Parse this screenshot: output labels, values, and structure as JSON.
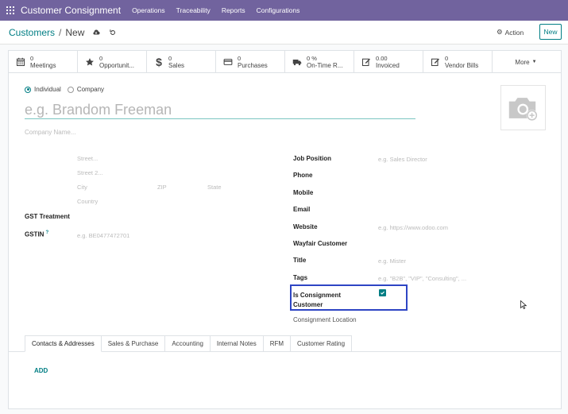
{
  "app": {
    "title": "Customer Consignment"
  },
  "menu": [
    "Operations",
    "Traceability",
    "Reports",
    "Configurations"
  ],
  "breadcrumb": {
    "parent": "Customers",
    "sep": "/",
    "current": "New"
  },
  "toolbar": {
    "action_label": "Action",
    "new_label": "New"
  },
  "smart_buttons": [
    {
      "value": "0",
      "label": "Meetings",
      "icon": "calendar-icon"
    },
    {
      "value": "0",
      "label": "Opportunit...",
      "icon": "star-icon"
    },
    {
      "value": "0",
      "label": "Sales",
      "icon": "dollar-icon"
    },
    {
      "value": "0",
      "label": "Purchases",
      "icon": "credit-card-icon"
    },
    {
      "value": "0 %",
      "label": "On-Time R...",
      "icon": "truck-icon"
    },
    {
      "value": "0.00",
      "label": "Invoiced",
      "icon": "edit-icon"
    },
    {
      "value": "0",
      "label": "Vendor Bills",
      "icon": "edit-icon"
    }
  ],
  "more_label": "More",
  "type_options": {
    "individual": "Individual",
    "company": "Company"
  },
  "name_placeholder": "e.g. Brandom Freeman",
  "company_placeholder": "Company Name...",
  "address": {
    "street": "Street...",
    "street2": "Street 2...",
    "city": "City",
    "zip": "ZIP",
    "state": "State",
    "country": "Country"
  },
  "left_fields": {
    "gst_treatment": "GST Treatment",
    "gstin": "GSTIN",
    "gstin_help": "?",
    "gstin_placeholder": "e.g. BE0477472701"
  },
  "right_fields": {
    "job_position": "Job Position",
    "job_position_placeholder": "e.g. Sales Director",
    "phone": "Phone",
    "mobile": "Mobile",
    "email": "Email",
    "website": "Website",
    "website_placeholder": "e.g. https://www.odoo.com",
    "wayfair": "Wayfair Customer",
    "title": "Title",
    "title_placeholder": "e.g. Mister",
    "tags": "Tags",
    "tags_placeholder": "e.g. \"B2B\", \"VIP\", \"Consulting\", ...",
    "is_consignment_line1": "Is Consignment",
    "is_consignment_line2": "Customer",
    "consignment_location": "Consignment Location"
  },
  "tabs": [
    "Contacts & Addresses",
    "Sales & Purchase",
    "Accounting",
    "Internal Notes",
    "RFM",
    "Customer Rating"
  ],
  "add_label": "ADD",
  "colors": {
    "topbar": "#71639e",
    "accent": "#017e84",
    "highlight_box": "#2e45c4"
  }
}
